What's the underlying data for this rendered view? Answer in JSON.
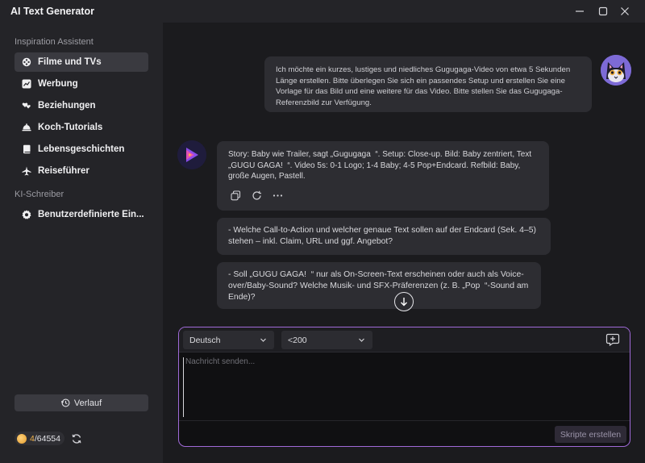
{
  "window": {
    "title": "AI Text Generator"
  },
  "sidebar": {
    "section1_label": "Inspiration Assistent",
    "items": [
      {
        "label": "Filme und TVs",
        "icon": "film-reel-icon"
      },
      {
        "label": "Werbung",
        "icon": "chart-icon"
      },
      {
        "label": "Beziehungen",
        "icon": "hearts-icon"
      },
      {
        "label": "Koch-Tutorials",
        "icon": "cloche-icon"
      },
      {
        "label": "Lebensgeschichten",
        "icon": "book-icon"
      },
      {
        "label": "Reiseführer",
        "icon": "airplane-icon"
      }
    ],
    "section2_label": "KI-Schreiber",
    "custom_item": {
      "label": "Benutzerdefinierte Ein...",
      "icon": "gear-icon"
    },
    "history_label": "Verlauf",
    "credits": {
      "used": "4",
      "total": "/64554"
    }
  },
  "chat": {
    "user_message": "Ich möchte ein kurzes, lustiges und niedliches Gugugaga-Video von etwa 5 Sekunden Länge erstellen. Bitte überlegen Sie sich ein passendes Setup und erstellen Sie eine Vorlage für das Bild und eine weitere für das Video. Bitte stellen Sie das Gugugaga-Referenzbild zur Verfügung.",
    "bot_message_1": "Story: Baby wie Trailer, sagt „Gugugaga  “. Setup: Close-up. Bild: Baby zentriert, Text „GUGU GAGA!  “. Video 5s: 0-1 Logo; 1-4 Baby; 4-5 Pop+Endcard. Refbild: Baby, große Augen, Pastell.",
    "bot_message_2": "- Welche Call-to-Action und welcher genaue Text sollen auf der Endcard (Sek. 4–5) stehen – inkl. Claim, URL und ggf. Angebot?",
    "bot_message_3": "- Soll „GUGU GAGA!  “ nur als On-Screen-Text erscheinen oder auch als Voice-over/Baby-Sound? Welche Musik- und SFX-Präferenzen (z. B. „Pop  “-Sound am Ende)?"
  },
  "composer": {
    "language": "Deutsch",
    "length": "<200",
    "placeholder": "Nachricht senden...",
    "submit_label": "Skripte erstellen"
  },
  "colors": {
    "accent_border": "#a06ad8",
    "credits_used": "#f0b24a",
    "active_nav": "#3a3a40"
  }
}
